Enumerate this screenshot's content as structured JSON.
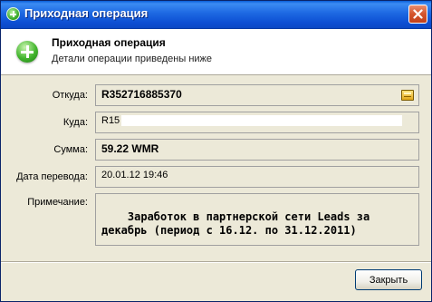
{
  "window": {
    "title": "Приходная операция"
  },
  "header": {
    "title": "Приходная операция",
    "subtitle": "Детали операции приведены ниже"
  },
  "fields": {
    "from": {
      "label": "Откуда:",
      "value": "R352716885370"
    },
    "to": {
      "label": "Куда:",
      "value_visible_prefix": "R15"
    },
    "amount": {
      "label": "Сумма:",
      "value": "59.22 WMR"
    },
    "date": {
      "label": "Дата перевода:",
      "value": "20.01.12 19:46"
    },
    "note": {
      "label": "Примечание:",
      "value": "Заработок в партнерской сети Leads за декабрь (период с 16.12. по 31.12.2011)"
    }
  },
  "footer": {
    "close_label": "Закрыть"
  },
  "colors": {
    "titlebar": "#0d4fd3",
    "window_bg": "#ece9d8",
    "close_button": "#d4542c",
    "accent_green": "#43b52e"
  },
  "icons": {
    "title": "plus-circle-icon",
    "header": "plus-circle-icon",
    "from_field": "wallet-icon",
    "close": "close-icon"
  }
}
